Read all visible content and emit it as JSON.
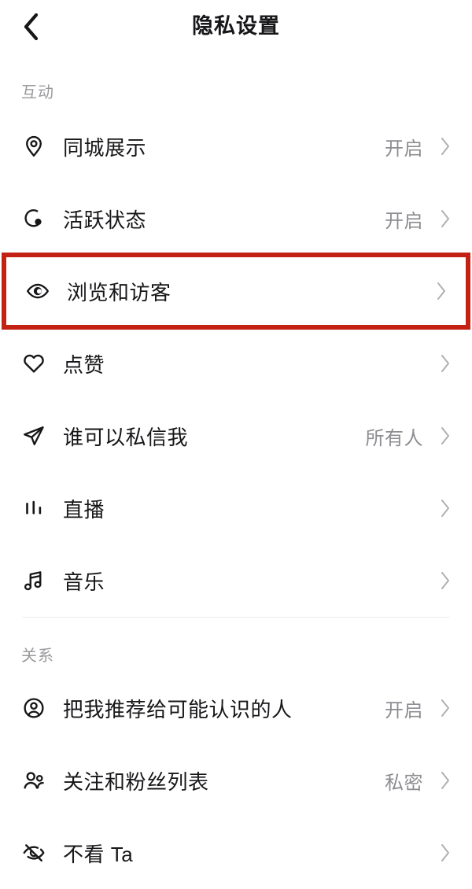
{
  "header": {
    "title": "隐私设置",
    "back_icon": "chevron-left-icon"
  },
  "colors": {
    "highlight": "#c22113",
    "text_primary": "#17171a",
    "text_secondary": "#8d8d92",
    "section_label": "#9a9a9e",
    "chevron": "#b0b0b4",
    "divider": "#ededf0",
    "background": "#ffffff"
  },
  "sections": [
    {
      "label": "互动",
      "items": [
        {
          "label": "同城展示",
          "value": "开启",
          "icon": "location-pin-icon",
          "highlighted": false
        },
        {
          "label": "活跃状态",
          "value": "开启",
          "icon": "activity-status-icon",
          "highlighted": false
        },
        {
          "label": "浏览和访客",
          "value": "",
          "icon": "eye-icon",
          "highlighted": true
        },
        {
          "label": "点赞",
          "value": "",
          "icon": "heart-icon",
          "highlighted": false
        },
        {
          "label": "谁可以私信我",
          "value": "所有人",
          "icon": "send-icon",
          "highlighted": false
        },
        {
          "label": "直播",
          "value": "",
          "icon": "live-bars-icon",
          "highlighted": false
        },
        {
          "label": "音乐",
          "value": "",
          "icon": "music-note-icon",
          "highlighted": false
        }
      ]
    },
    {
      "label": "关系",
      "items": [
        {
          "label": "把我推荐给可能认识的人",
          "value": "开启",
          "icon": "user-circle-icon",
          "highlighted": false
        },
        {
          "label": "关注和粉丝列表",
          "value": "私密",
          "icon": "users-group-icon",
          "highlighted": false
        },
        {
          "label": "不看 Ta",
          "value": "",
          "icon": "eye-off-icon",
          "highlighted": false
        }
      ]
    }
  ]
}
